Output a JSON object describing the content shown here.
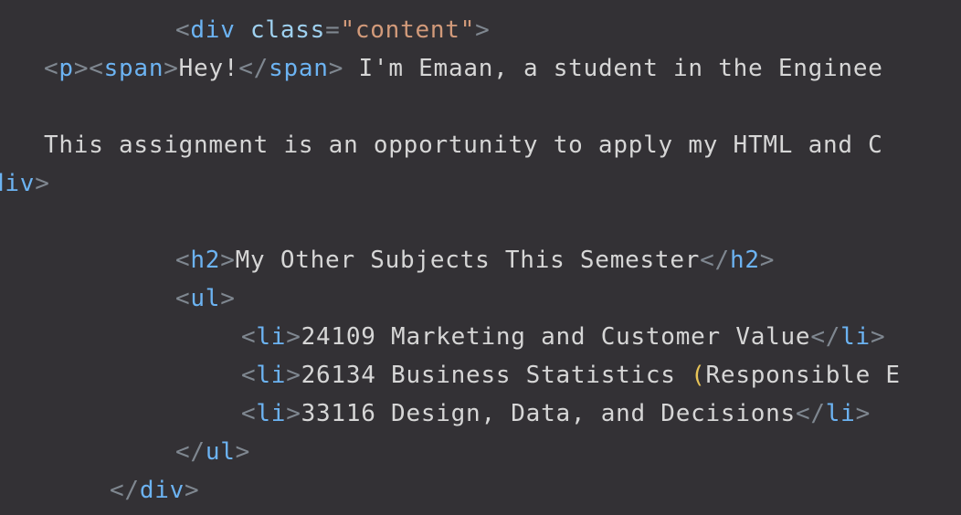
{
  "editor": {
    "line1": {
      "open": "<",
      "tag": "div",
      "space": " ",
      "attr": "class",
      "eq": "=",
      "value": "\"content\"",
      "close": ">"
    },
    "line2": {
      "p_open": "<",
      "p_tag": "p",
      "p_close": ">",
      "span_open": "<",
      "span_tag": "span",
      "span_close": ">",
      "span_text": "Hey!",
      "span_end_open": "</",
      "span_end_tag": "span",
      "span_end_close": ">",
      "text": " I'm Emaan, a student in the Enginee"
    },
    "line3": {
      "text": "This assignment is an opportunity to apply my HTML and C"
    },
    "line4": {
      "tag": "div",
      "close": ">"
    },
    "line5": {
      "open": "<",
      "tag": "h2",
      "close": ">",
      "text": "My Other Subjects This Semester",
      "end_open": "</",
      "end_tag": "h2",
      "end_close": ">"
    },
    "line6": {
      "open": "<",
      "tag": "ul",
      "close": ">"
    },
    "list_items": [
      {
        "open": "<",
        "tag": "li",
        "close": ">",
        "text": "24109 Marketing and Customer Value",
        "end_open": "</",
        "end_tag": "li",
        "end_close": ">"
      },
      {
        "open": "<",
        "tag": "li",
        "close": ">",
        "text": "26134 Business Statistics ",
        "paren": "(",
        "text2": "Responsible E"
      },
      {
        "open": "<",
        "tag": "li",
        "close": ">",
        "text": "33116 Design, Data, and Decisions",
        "end_open": "</",
        "end_tag": "li",
        "end_close": ">"
      }
    ],
    "line10": {
      "open": "</",
      "tag": "ul",
      "close": ">"
    },
    "line11": {
      "open": "</",
      "tag": "div",
      "close": ">"
    }
  }
}
